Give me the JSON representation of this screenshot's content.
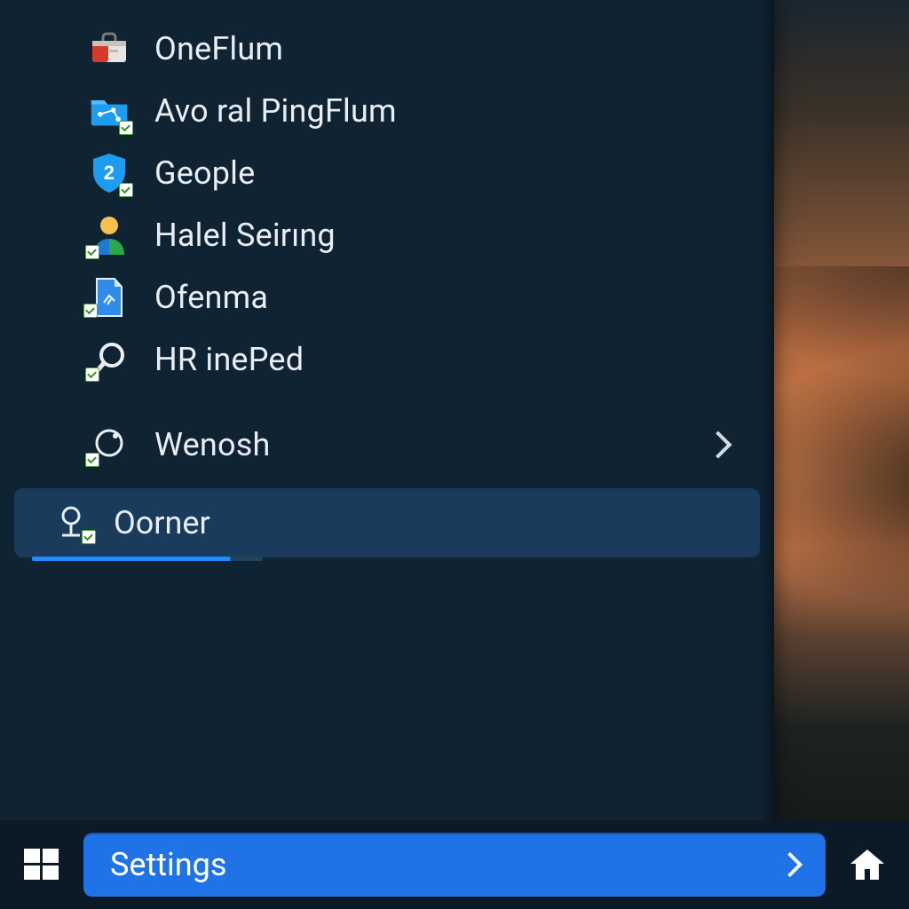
{
  "menu": {
    "apps": [
      {
        "label": "OneFlum",
        "icon": "toolbox-icon"
      },
      {
        "label": "Avo ral PingFlum",
        "icon": "folder-icon"
      },
      {
        "label": "Geople",
        "icon": "shield-icon",
        "icon_text": "2"
      },
      {
        "label": "Halel Seirıng",
        "icon": "person-icon"
      },
      {
        "label": "Ofenma",
        "icon": "document-icon"
      },
      {
        "label": "HR inePed",
        "icon": "search-icon"
      }
    ],
    "expandable": {
      "label": "Wenosh",
      "icon": "loop-icon"
    },
    "search": {
      "label": "Oorner",
      "icon": "pin-icon"
    }
  },
  "taskbar": {
    "settings_label": "Settings"
  },
  "colors": {
    "panel_bg": "#0f2333",
    "accent": "#1f73e6",
    "text": "#e9eef3"
  }
}
